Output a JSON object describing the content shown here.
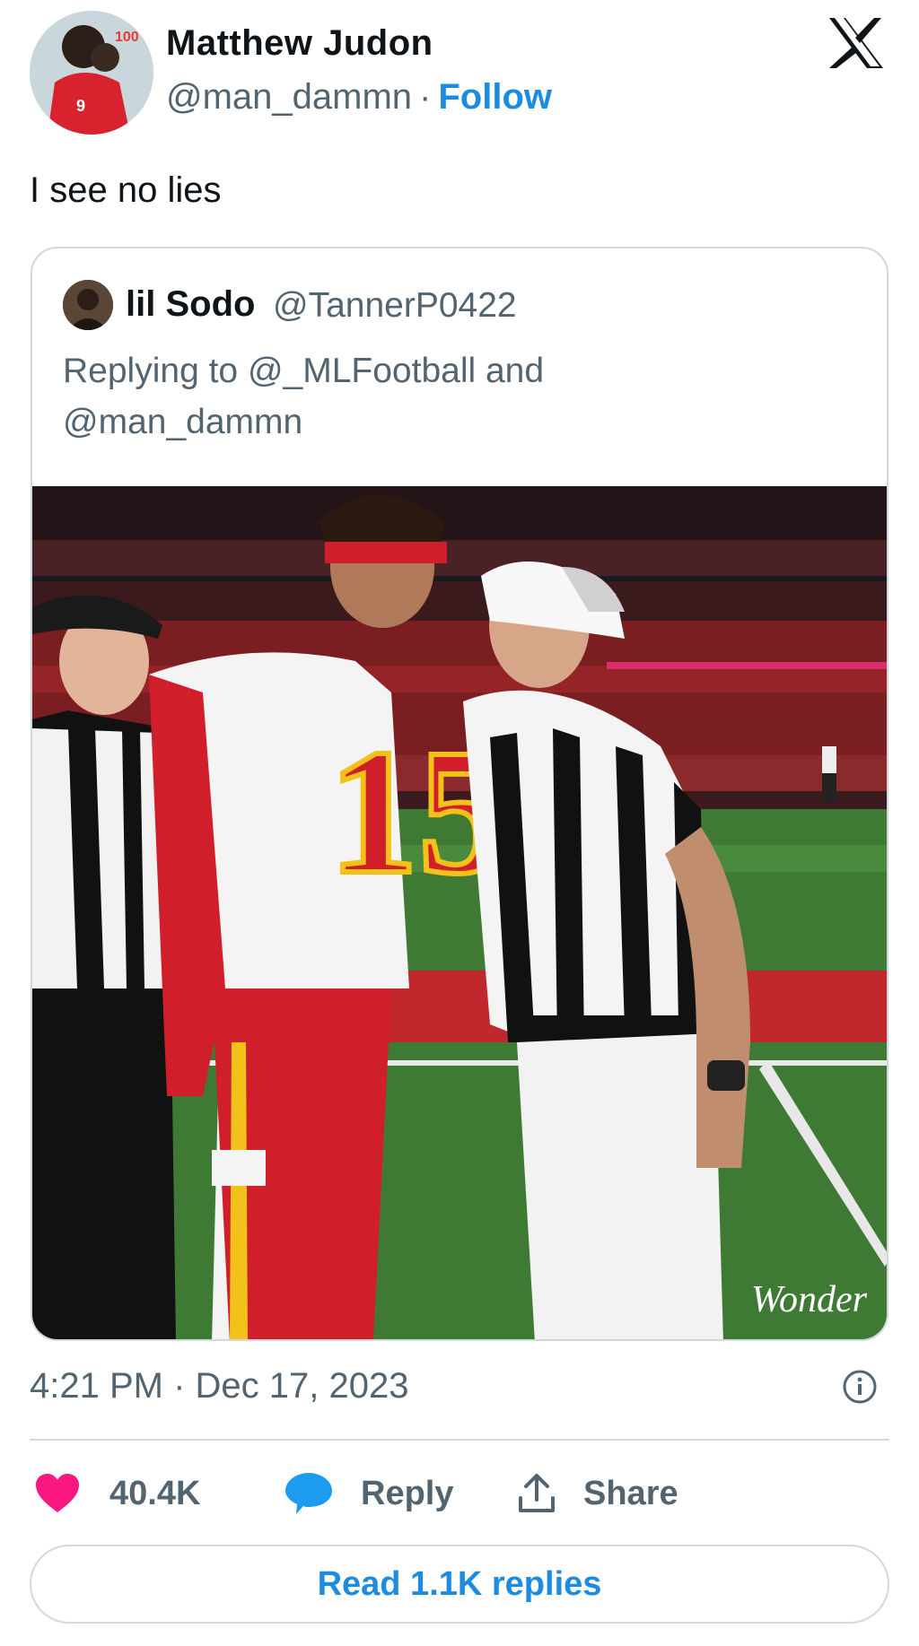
{
  "author": {
    "name": "Matthew Judon",
    "handle": "@man_dammn",
    "separator": "·",
    "follow_label": "Follow"
  },
  "tweet": {
    "text": "I see no lies",
    "timestamp": "4:21 PM · Dec 17, 2023"
  },
  "quoted_tweet": {
    "name": "lil Sodo",
    "handle": "@TannerP0422",
    "replying_to": "Replying to @_MLFootball and @man_dammn",
    "image_watermark": "Wonder",
    "jersey_number": "15"
  },
  "actions": {
    "likes_count": "40.4K",
    "reply_label": "Reply",
    "share_label": "Share"
  },
  "read_replies_label": "Read 1.1K replies",
  "colors": {
    "accent": "#1d8ce0",
    "like": "#f91880",
    "text_secondary": "#536471",
    "border": "#cfd9de"
  },
  "icons": {
    "brand": "x-logo-icon",
    "info": "info-icon",
    "like": "heart-icon",
    "reply": "speech-bubble-icon",
    "share": "share-icon"
  }
}
